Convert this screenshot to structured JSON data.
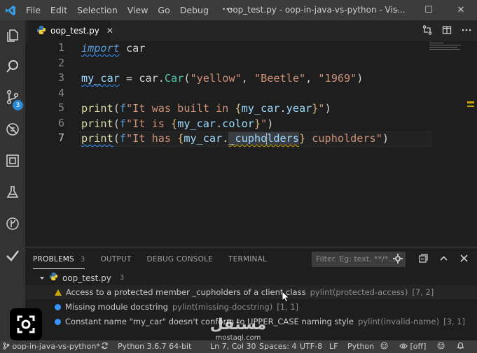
{
  "titlebar": {
    "menu": [
      "File",
      "Edit",
      "Selection",
      "View",
      "Go",
      "Debug",
      "•••"
    ],
    "title": "oop_test.py - oop-in-java-vs-python - Vis...",
    "controls": [
      "–",
      "☐",
      "✕"
    ]
  },
  "activity": {
    "scm_badge": "3",
    "items": [
      "explorer-icon",
      "search-icon",
      "source-control-icon",
      "debug-icon",
      "extensions-icon",
      "flask-icon",
      "gitlens-icon",
      "check-icon"
    ]
  },
  "tab": {
    "label": "oop_test.py",
    "close": "✕"
  },
  "editor": {
    "line_numbers": [
      "1",
      "2",
      "3",
      "4",
      "5",
      "6",
      "7"
    ],
    "line1": {
      "kw": "import",
      "rest": " car"
    },
    "line3": {
      "var": "my_car",
      "eq": " = ",
      "mod": "car",
      "dot": ".",
      "cls": "Car",
      "open": "(",
      "s1": "\"yellow\"",
      "c1": ", ",
      "s2": "\"Beetle\"",
      "c2": ", ",
      "s3": "\"1969\"",
      "close": ")"
    },
    "line5": {
      "fn": "print",
      "open": "(",
      "f": "f",
      "s": "\"It was built in ",
      "lb": "{",
      "obj": "my_car",
      "dot": ".",
      "attr": "year",
      "rb": "}",
      "e": "\"",
      "close": ")"
    },
    "line6": {
      "fn": "print",
      "open": "(",
      "f": "f",
      "s": "\"It is ",
      "lb": "{",
      "obj": "my_car",
      "dot": ".",
      "attr": "color",
      "rb": "}",
      "e": "\"",
      "close": ")"
    },
    "line7": {
      "fn": "print",
      "open": "(",
      "f": "f",
      "s": "\"It has ",
      "lb": "{",
      "obj": "my_car",
      "dot": ".",
      "attr_a": "_cupho",
      "attr_b": "lders",
      "rb": "}",
      "e": " cupholders\"",
      "close": ")"
    }
  },
  "panel": {
    "tabs": [
      {
        "label": "PROBLEMS",
        "count": "3"
      },
      {
        "label": "OUTPUT"
      },
      {
        "label": "DEBUG CONSOLE"
      },
      {
        "label": "TERMINAL"
      }
    ],
    "filter_placeholder": "Filter. Eg: text, **/*....",
    "file": {
      "name": "oop_test.py",
      "count": "3"
    },
    "problems": [
      {
        "severity": "warning",
        "message": "Access to a protected member _cupholders of a client class",
        "source": "pylint(protected-access)",
        "pos": "[7, 2]"
      },
      {
        "severity": "info",
        "message": "Missing module docstring",
        "source": "pylint(missing-docstring)",
        "pos": "[1, 1]"
      },
      {
        "severity": "info",
        "message": "Constant name \"my_car\" doesn't conform to UPPER_CASE naming style",
        "source": "pylint(invalid-name)",
        "pos": "[3, 1]"
      }
    ]
  },
  "statusbar": {
    "branch": "oop-in-java-vs-python*",
    "python": "Python 3.6.7 64-bit",
    "position": "Ln 7, Col 30",
    "spaces": "Spaces: 4",
    "encoding": "UTF-8",
    "eol": "LF",
    "language": "Python",
    "live": "[off]"
  },
  "watermark": {
    "arabic": "مستقل",
    "latin": "mostaql.com"
  },
  "colors": {
    "accent": "#3794ff",
    "warning": "#cca700",
    "badge": "#2a8ad4"
  }
}
